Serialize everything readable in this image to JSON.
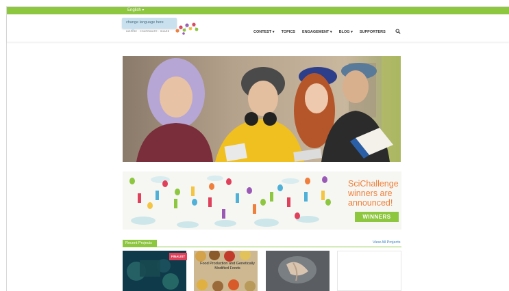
{
  "topbar": {
    "language": "English ▾"
  },
  "header": {
    "tooltip": "change language here",
    "tagline": "INSPIRE · CONTRIBUTE · SHARE",
    "nav": [
      {
        "label": "CONTEST ▾"
      },
      {
        "label": "TOPICS"
      },
      {
        "label": "ENGAGEMENT ▾"
      },
      {
        "label": "BLOG ▾"
      },
      {
        "label": "SUPPORTERS"
      }
    ]
  },
  "banner": {
    "line1": "SciChallenge",
    "line2": "winners are",
    "line3": "announced!",
    "button": "WINNERS"
  },
  "projects": {
    "heading": "Recent Projects",
    "link": "View All Projects",
    "badge": "FINALIST",
    "card2_text": "Food Production and Genetically Modified Foods"
  },
  "colors": {
    "accent": "#8dc63f",
    "banner_text": "#f07f3c",
    "badge": "#e0405a"
  }
}
